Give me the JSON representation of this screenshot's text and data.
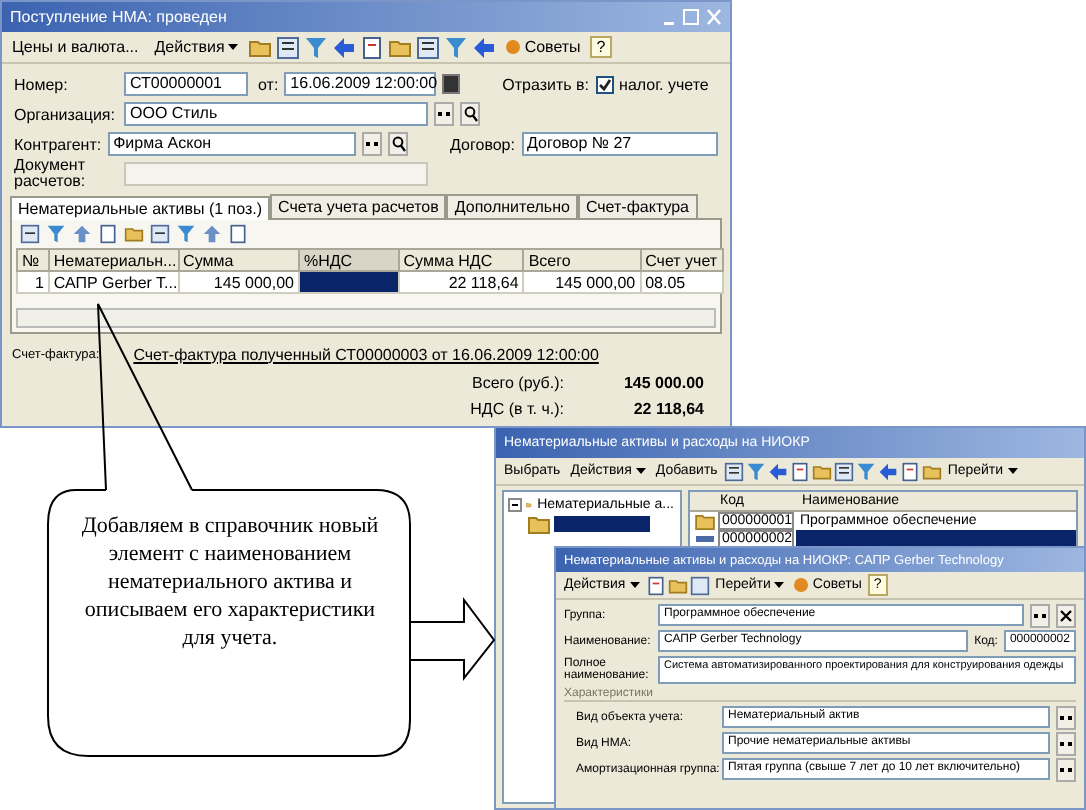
{
  "document_window": {
    "title": "Поступление НМА: проведен",
    "toolbar": [
      {
        "kind": "button",
        "label": "Цены и валюта..."
      },
      {
        "kind": "menu",
        "label": "Действия"
      },
      {
        "kind": "icon"
      },
      {
        "kind": "icon"
      },
      {
        "kind": "icon"
      },
      {
        "kind": "icon"
      },
      {
        "kind": "icon"
      },
      {
        "kind": "icon"
      },
      {
        "kind": "icon"
      },
      {
        "kind": "icon"
      },
      {
        "kind": "icon"
      },
      {
        "kind": "advice",
        "label": "Советы"
      },
      {
        "kind": "help",
        "label": "?"
      }
    ],
    "number": {
      "label": "Номер:",
      "value": "СТ00000001"
    },
    "date": {
      "label": "от:",
      "value": "16.06.2009 12:00:00"
    },
    "reflect": {
      "label": "Отразить в:",
      "option": "налог. учете",
      "checked": true
    },
    "organization": {
      "label": "Организация:",
      "value": "ООО Стиль"
    },
    "counterparty": {
      "label": "Контрагент:",
      "value": "Фирма Аскон"
    },
    "contract": {
      "label": "Договор:",
      "value": "Договор № 27"
    },
    "settlement_doc": {
      "label": "Документ расчетов:",
      "disabled": true
    },
    "tabs": [
      {
        "label": "Нематериальные активы (1 поз.)",
        "selected": true
      },
      {
        "label": "Счета учета расчетов",
        "selected": false
      },
      {
        "label": "Дополнительно",
        "selected": false
      },
      {
        "label": "Счет-фактура",
        "selected": false
      }
    ],
    "table": {
      "columns": [
        "№",
        "Нематериальн...",
        "Сумма",
        "%НДС",
        "Сумма НДС",
        "Всего",
        "Счет учет"
      ],
      "rows": [
        {
          "number": "1",
          "asset": "САПР Gerber T...",
          "sum": "145 000,00",
          "vat_rate_selected": true,
          "vat_sum": "22 118,64",
          "total": "145 000,00",
          "account": "08.05"
        }
      ]
    },
    "invoice": {
      "label": "Счет-фактура:",
      "link": "Счет-фактура полученный СТ00000003 от 16.06.2009 12:00:00"
    },
    "totals": [
      {
        "label": "Всего (руб.):",
        "value": "145 000.00"
      },
      {
        "label": "НДС (в т. ч.):",
        "value": "22 118,64"
      }
    ]
  },
  "callout": {
    "text": "Добавляем в справочник новый элемент с наименованием нематериального актива и описываем его характеристики для учета."
  },
  "catalog_window": {
    "title": "Нематериальные активы и расходы на НИОКР",
    "toolbar": [
      {
        "kind": "button",
        "label": "Выбрать"
      },
      {
        "kind": "menu",
        "label": "Действия"
      },
      {
        "kind": "button",
        "label": "Добавить"
      },
      {
        "kind": "icon"
      },
      {
        "kind": "icon"
      },
      {
        "kind": "icon"
      },
      {
        "kind": "icon"
      },
      {
        "kind": "icon"
      },
      {
        "kind": "icon"
      },
      {
        "kind": "icon"
      },
      {
        "kind": "icon"
      },
      {
        "kind": "icon"
      },
      {
        "kind": "icon"
      },
      {
        "kind": "menu",
        "label": "Перейти"
      }
    ],
    "tree": [
      {
        "label": "Нематериальные а...",
        "expanded": true,
        "selected": false,
        "children": [
          {
            "selected": true
          }
        ]
      }
    ],
    "columns": [
      "Код",
      "Наименование"
    ],
    "rows": [
      {
        "code": "000000001",
        "name": "Программное обеспечение",
        "kind": "group",
        "selected": false
      },
      {
        "code": "000000002",
        "kind": "item",
        "selected": true
      }
    ]
  },
  "element_window": {
    "title": "Нематериальные активы и расходы на НИОКР: САПР Gerber Technology",
    "toolbar": [
      {
        "kind": "menu",
        "label": "Действия"
      },
      {
        "kind": "icon"
      },
      {
        "kind": "icon"
      },
      {
        "kind": "icon"
      },
      {
        "kind": "menu",
        "label": "Перейти"
      },
      {
        "kind": "advice",
        "label": "Советы"
      },
      {
        "kind": "help",
        "label": "?"
      }
    ],
    "group": {
      "label": "Группа:",
      "value": "Программное обеспечение"
    },
    "name": {
      "label": "Наименование:",
      "value": "САПР Gerber Technology"
    },
    "code": {
      "label": "Код:",
      "value": "000000002"
    },
    "full_name": {
      "label": "Полное наименование:",
      "value": "Система автоматизированного проектирования для конструирования одежды"
    },
    "section": "Характеристики",
    "characteristics": [
      {
        "label": "Вид объекта учета:",
        "value": "Нематериальный актив"
      },
      {
        "label": "Вид НМА:",
        "value": "Прочие нематериальные активы"
      },
      {
        "label": "Амортизационная группа:",
        "value": "Пятая группа (свыше 7 лет до 10 лет включительно)"
      }
    ]
  }
}
